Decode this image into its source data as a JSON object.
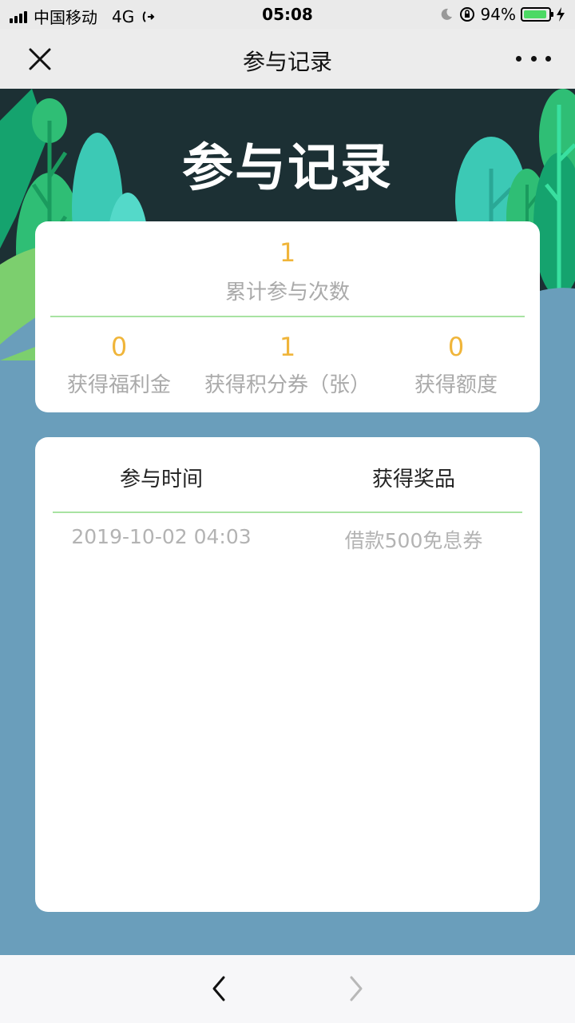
{
  "status_bar": {
    "carrier": "中国移动",
    "network": "4G",
    "time": "05:08",
    "battery": "94%",
    "battery_level": 0.94
  },
  "nav": {
    "title": "参与记录"
  },
  "hero": {
    "title": "参与记录"
  },
  "stats": {
    "total_value": "1",
    "total_label": "累计参与次数",
    "items": [
      {
        "value": "0",
        "label": "获得福利金"
      },
      {
        "value": "1",
        "label": "获得积分券（张）"
      },
      {
        "value": "0",
        "label": "获得额度"
      }
    ]
  },
  "records": {
    "headers": [
      "参与时间",
      "获得奖品"
    ],
    "rows": [
      {
        "time": "2019-10-02 04:03",
        "prize": "借款500免息券"
      }
    ]
  },
  "colors": {
    "accent_number": "#f0b53a",
    "divider": "#a8e3a2",
    "page_background": "#6a9ebb",
    "hero_background": "#1c3034"
  },
  "icons": [
    "signal-icon",
    "call-forward-icon",
    "moon-icon",
    "rotation-lock-icon",
    "battery-icon",
    "charging-icon",
    "close-icon",
    "more-icon",
    "back-arrow-icon",
    "forward-arrow-icon"
  ]
}
